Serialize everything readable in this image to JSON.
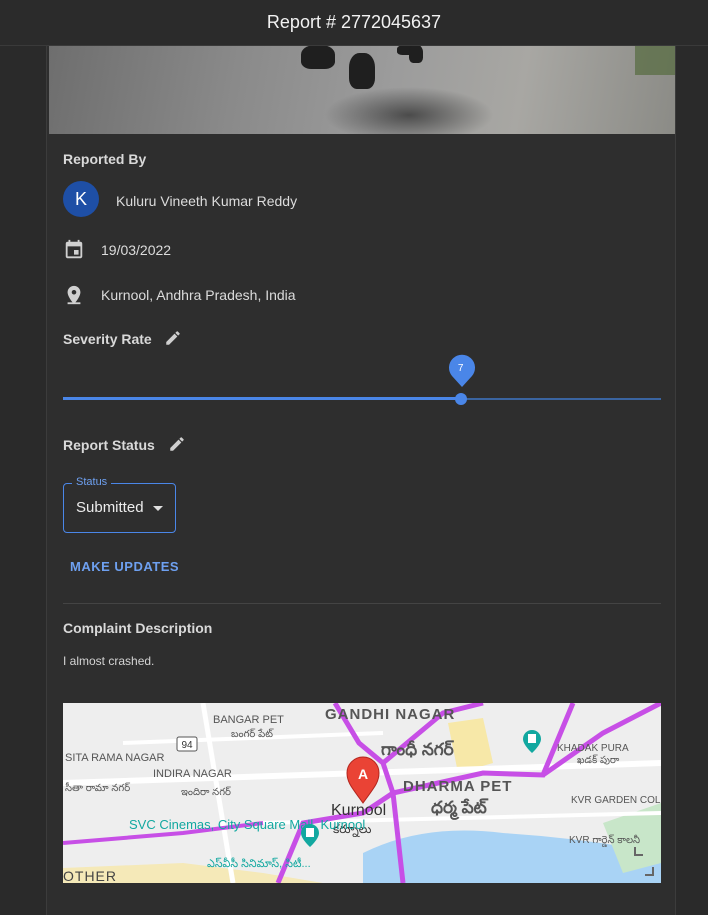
{
  "header": {
    "title": "Report # 2772045637"
  },
  "reporter": {
    "section_title": "Reported By",
    "avatar_letter": "K",
    "name": "Kuluru Vineeth Kumar Reddy",
    "date": "19/03/2022",
    "location": "Kurnool, Andhra Pradesh, India"
  },
  "severity": {
    "section_title": "Severity Rate",
    "value": 7,
    "value_label": "7",
    "max": 10
  },
  "status": {
    "section_title": "Report Status",
    "field_label": "Status",
    "selected": "Submitted",
    "update_button": "MAKE UPDATES"
  },
  "complaint": {
    "section_title": "Complaint Description",
    "text": "I almost crashed."
  },
  "map": {
    "marker_letter": "A",
    "labels": {
      "gandhi_nagar": "GANDHI NAGAR",
      "gandhi_nagar_te": "గాంధీ నగర్",
      "bangar_pet": "BANGAR PET",
      "bangar_pet_te": "బంగర్ పేట్",
      "sita_rama_nagar": "SITA RAMA NAGAR",
      "sita_rama_nagar_te": "సీతా రామా నగర్",
      "indira_nagar": "INDIRA NAGAR",
      "indira_nagar_te": "ఇందిరా నగర్",
      "dharma_pet": "DHARMA PET",
      "dharma_pet_te": "ధర్మ పేట్",
      "kurnool": "Kurnool",
      "kurnool_te": "కర్నూలు",
      "svc": "SVC Cinemas, City Square Mall, Kurnool",
      "svc_te": "ఎస్‌వీసీ సినిమాస్, సిటీ...",
      "khadak_pura": "KHADAK PURA",
      "khadak_pura_te": "ఖడక్ పురా",
      "kvr_garden": "KVR GARDEN COLONY",
      "kvr_garden_te": "KVR గార్డెన్ కాలనీ",
      "other": "OTHER",
      "road_94": "94"
    },
    "colors": {
      "road": "#c74fe6",
      "water": "#a9d3f5",
      "park": "#c8e6c9",
      "marker": "#ea4335",
      "poi": "#12a8a0"
    }
  },
  "icons": {
    "date": "calendar-icon",
    "location": "location-pin-icon",
    "edit": "pencil-icon"
  },
  "colors": {
    "accent": "#4a86e8",
    "avatar": "#1e4fa6",
    "background": "#2e2e2e"
  }
}
